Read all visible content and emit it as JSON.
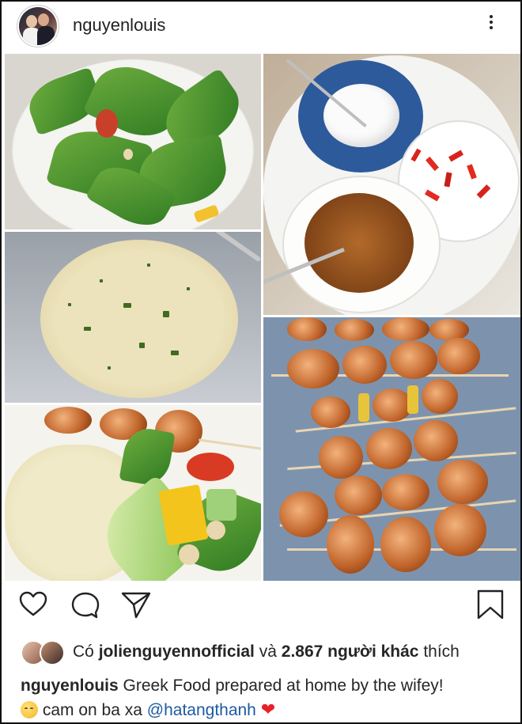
{
  "post": {
    "username": "nguyenlouis",
    "more_icon": "more-vertical-icon"
  },
  "images": [
    {
      "name": "salad-photo",
      "alt": "green salad"
    },
    {
      "name": "couscous-photo",
      "alt": "couscous with herbs"
    },
    {
      "name": "plated-meal-photo",
      "alt": "couscous, salad and shrimp"
    },
    {
      "name": "dips-photo",
      "alt": "sauces and chili"
    },
    {
      "name": "skewers-photo",
      "alt": "grilled shrimp skewers"
    }
  ],
  "actions": {
    "like_icon": "heart-icon",
    "comment_icon": "comment-icon",
    "share_icon": "send-icon",
    "save_icon": "bookmark-icon"
  },
  "likes": {
    "prefix": "Có",
    "liker": "jolienguyennofficial",
    "conjunction": "và",
    "others": "2.867 người khác",
    "suffix": "thích"
  },
  "caption": {
    "username": "nguyenlouis",
    "text": "Greek Food prepared at home by the wifey!",
    "line2_text": "cam on ba xa",
    "mention": "@hatangthanh",
    "heart": "❤"
  },
  "colors": {
    "text": "#262626",
    "mention": "#1d5aa0",
    "heart": "#e8202a"
  }
}
